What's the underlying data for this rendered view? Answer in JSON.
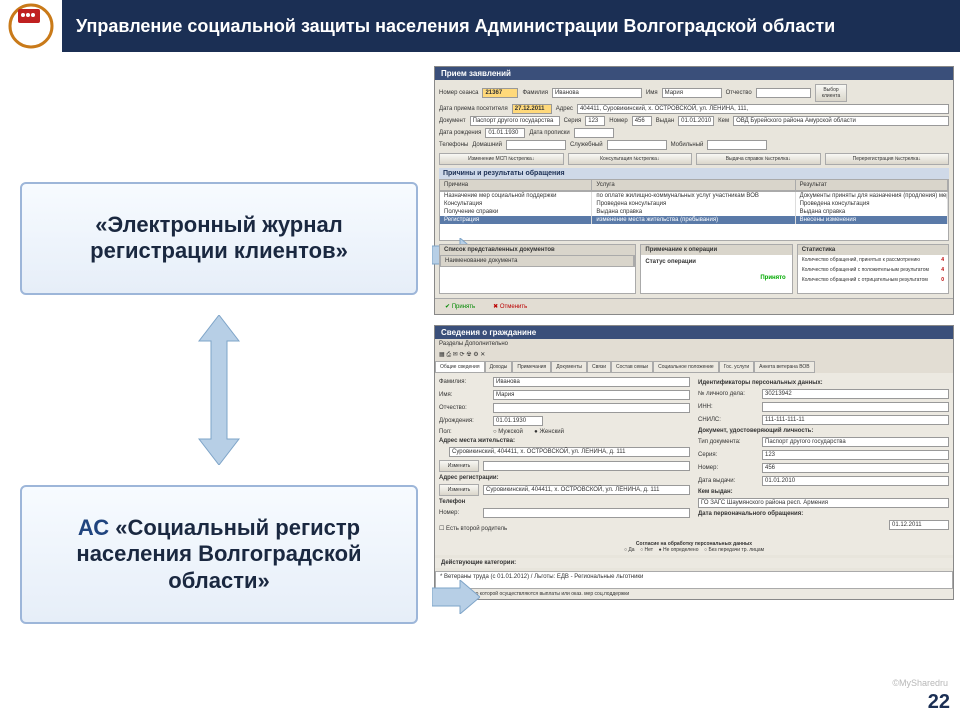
{
  "header": {
    "title": "Управление социальной защиты населения Администрации Волгоградской области"
  },
  "cards": {
    "top": "«Электронный журнал регистрации клиентов»",
    "bottom_prefix": "АС",
    "bottom_rest": " «Социальный регистр населения Волгоградской области»"
  },
  "window1": {
    "title": "Прием заявлений",
    "fields": {
      "session_no_label": "Номер сеанса",
      "session_no": "21367",
      "surname_label": "Фамилия",
      "surname": "Иванова",
      "name_label": "Имя",
      "name": "Мария",
      "patronymic_label": "Отчество",
      "visit_date_label": "Дата приема посетителя",
      "visit_date": "27.12.2011",
      "address_label": "Адрес",
      "address": "404411, Суровикинский, х. ОСТРОВСКОЙ, ул. ЛЕНИНА, 111,",
      "doc_label": "Документ",
      "doc": "Паспорт другого государства",
      "series_label": "Серия",
      "series": "123",
      "number_label": "Номер",
      "number": "456",
      "issued_label": "Выдан",
      "issued": "01.01.2010",
      "issuer_label": "Кем",
      "issuer": "ОВД Бурейского района Амурской области",
      "birth_label": "Дата рождения",
      "birth": "01.01.1930",
      "reg_date_label": "Дата прописки",
      "phones_label": "Телефоны",
      "home": "Домашний",
      "work": "Служебный",
      "mobile": "Мобильный"
    },
    "buttons": [
      "Изменение МСП №стрелка↓",
      "Консультация №стрелка↓",
      "Выдача справок №стрелка↓",
      "Перерегистрация №стрелка↓"
    ],
    "section1": "Причины и результаты обращения",
    "select_client_btn": "Выбор клиента",
    "table": {
      "headers": [
        "Причина",
        "Услуга",
        "Результат"
      ],
      "rows": [
        [
          "Назначение мер социальной поддержки",
          "по оплате жилищно-коммунальных услуг участникам ВОВ",
          "Документы приняты для назначения (продления) мер социаль"
        ],
        [
          "Консультация",
          "Проведена консультация",
          "Проведена консультация"
        ],
        [
          "Получение справки",
          "Выдана справка",
          "Выдана справка"
        ],
        [
          "Регистрация",
          "изменение места жительства (пребывания)",
          "Внесены изменения"
        ]
      ]
    },
    "section_docs": "Список представленных документов",
    "section_note": "Примечание к операции",
    "section_stats": "Статистика",
    "docs_header": "Наименование документа",
    "status_label": "Статус операции",
    "status_value": "Принято",
    "stats": [
      {
        "label": "Количество обращений, принятых к рассмотрению",
        "num": "4"
      },
      {
        "label": "Количество обращений с положительным результатом",
        "num": "4"
      },
      {
        "label": "Количество обращений с отрицательным результатом",
        "num": "0"
      }
    ],
    "footer": {
      "print": "Принять",
      "cancel": "Отменить"
    }
  },
  "window2": {
    "title": "Сведения о гражданине",
    "menu": "Разделы  Дополнительно",
    "tabs": [
      "Общие сведения",
      "Доходы",
      "Примечания",
      "Документы",
      "Связи",
      "Состав семьи",
      "Социальное положение",
      "Гос. услуги",
      "Анкета ветерана ВОВ"
    ],
    "left": {
      "surname_label": "Фамилия:",
      "surname": "Иванова",
      "name_label": "Имя:",
      "name": "Мария",
      "patr_label": "Отчество:",
      "birth_label": "Д/рождения:",
      "birth": "01.01.1930",
      "sex_label": "Пол:",
      "sex_m": "Мужской",
      "sex_f": "Женский",
      "addr_title": "Адрес места жительства:",
      "addr": "Суровикинский, 404411, х. ОСТРОВСКОЙ, ул. ЛЕНИНА, д. 111",
      "change_btn": "Изменить",
      "reg_title": "Адрес регистрации:",
      "reg_addr": "Суровикинский, 404411, х. ОСТРОВСКОЙ, ул. ЛЕНИНА, д. 111",
      "phone_title": "Телефон",
      "phone_label": "Номер:",
      "parent2": "Есть второй родитель",
      "consent": "Согласие на обработку персональных данных",
      "yes": "Да",
      "no": "Нет",
      "undef": "Не определено",
      "no3rd": "Без передачи тр. лицам",
      "categories": "Действующие категории:",
      "cat_row": "* Ветераны труда (с 01.01.2012) / Льготы: ЕДВ - Региональные льготники",
      "footnote": "* - категория, по которой осуществляются выплаты или оказ. мер соц.поддержки"
    },
    "right": {
      "ids_title": "Идентификаторы персональных данных:",
      "file_no_label": "№ личного дела:",
      "file_no": "30213942",
      "inn_label": "ИНН:",
      "snils_label": "СНИЛС:",
      "snils": "111-111-111-11",
      "doc_title": "Документ, удостоверяющий личность:",
      "type_label": "Тип документа:",
      "type": "Паспорт другого государства",
      "series_label": "Серия:",
      "series": "123",
      "number_label": "Номер:",
      "number": "456",
      "issued_label": "Дата выдачи:",
      "issued": "01.01.2010",
      "issuer_label": "Кем выдан:",
      "issuer": "ГО ЗАГС Шаумянского района респ. Армения",
      "first_appeal": "Дата первоначального обращения:",
      "first_date": "01.12.2011"
    }
  },
  "page_number": "22",
  "watermark": "©MySharedru"
}
